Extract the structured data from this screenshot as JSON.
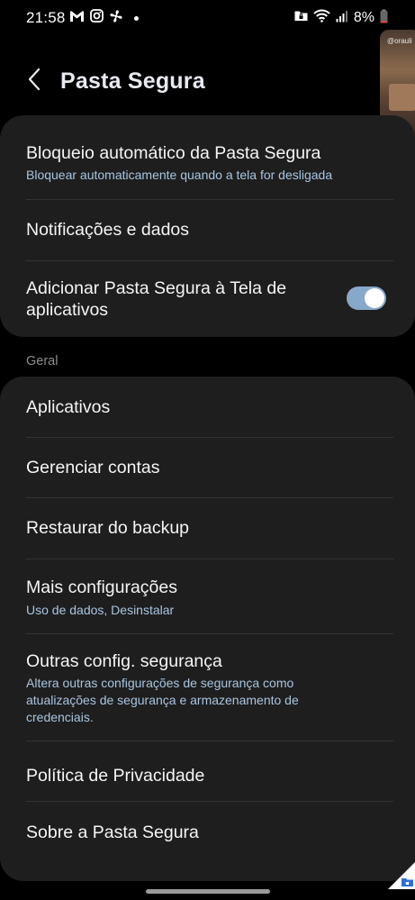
{
  "status_bar": {
    "time": "21:58",
    "battery_percent": "8%",
    "left_icons": [
      "gmail-icon",
      "instagram-icon",
      "fan-icon",
      "dot-icon"
    ],
    "right_icons": [
      "secure-folder-icon",
      "wifi-icon",
      "signal-icon",
      "battery-icon"
    ]
  },
  "floating_thumbnail": {
    "label": "@orauli"
  },
  "header": {
    "title": "Pasta Segura"
  },
  "card_top": {
    "items": [
      {
        "title": "Bloqueio automático da Pasta Segura",
        "subtitle": "Bloquear automaticamente quando a tela for desligada"
      },
      {
        "title": "Notificações e dados"
      },
      {
        "title_line1": "Adicionar Pasta Segura à Tela de",
        "title_line2": "aplicativos",
        "toggle_on": true
      }
    ]
  },
  "section": {
    "label": "Geral"
  },
  "card_general": {
    "items": [
      {
        "title": "Aplicativos"
      },
      {
        "title": "Gerenciar contas"
      },
      {
        "title": "Restaurar do backup"
      },
      {
        "title": "Mais configurações",
        "subtitle": "Uso de dados, Desinstalar"
      },
      {
        "title": "Outras config. segurança",
        "subtitle_line1": "Altera outras configurações de segurança como",
        "subtitle_line2": "atualizações de segurança e armazenamento de",
        "subtitle_line3": "credenciais."
      },
      {
        "title": "Política de Privacidade"
      },
      {
        "title": "Sobre a Pasta Segura"
      }
    ]
  },
  "colors": {
    "background": "#000000",
    "card": "#1e1e1e",
    "subtitle": "#a9c5e0",
    "toggle_track": "#87a9c9",
    "section_label": "#8e8e8e"
  }
}
